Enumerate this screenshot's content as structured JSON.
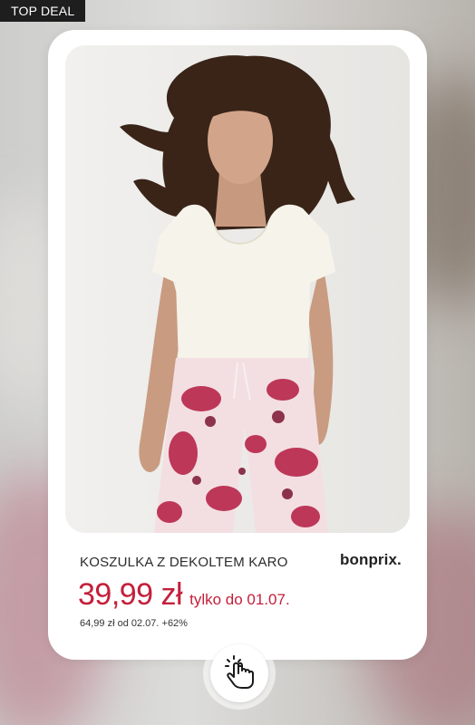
{
  "badge": {
    "label": "TOP DEAL"
  },
  "product": {
    "name": "KOSZULKA Z DEKOLTEM KARO",
    "brand": "bonprix.",
    "price": "39,99 zł",
    "price_note": "tylko do 01.07.",
    "old_price_text": "64,99 zł od 02.07. +62%"
  },
  "cta": {
    "icon": "tap-hand-icon"
  },
  "colors": {
    "accent": "#c3203b",
    "badge_bg": "#1e1e1e",
    "card_bg": "#ffffff"
  }
}
